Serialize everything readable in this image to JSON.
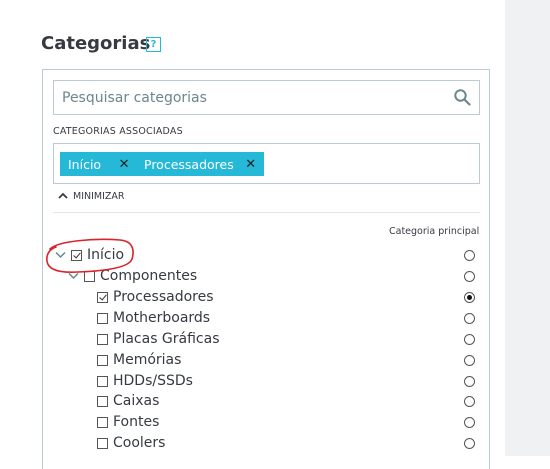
{
  "title": "Categorias",
  "help_icon": "?",
  "search": {
    "placeholder": "Pesquisar categorias",
    "value": ""
  },
  "associated_label": "CATEGORIAS ASSOCIADAS",
  "tags": [
    {
      "label": "Início"
    },
    {
      "label": "Processadores"
    }
  ],
  "minimize_label": "MINIMIZAR",
  "principal_label": "Categoria principal",
  "tree": [
    {
      "label": "Início",
      "checked": true,
      "expander": "expanded",
      "principal": false
    },
    {
      "label": "Componentes",
      "checked": false,
      "expander": "expanded",
      "principal": false
    },
    {
      "label": "Processadores",
      "checked": true,
      "expander": "",
      "principal": true
    },
    {
      "label": "Motherboards",
      "checked": false,
      "expander": "",
      "principal": false
    },
    {
      "label": "Placas Gráficas",
      "checked": false,
      "expander": "",
      "principal": false
    },
    {
      "label": "Memórias",
      "checked": false,
      "expander": "",
      "principal": false
    },
    {
      "label": "HDDs/SSDs",
      "checked": false,
      "expander": "",
      "principal": false
    },
    {
      "label": "Caixas",
      "checked": false,
      "expander": "",
      "principal": false
    },
    {
      "label": "Fontes",
      "checked": false,
      "expander": "",
      "principal": false
    },
    {
      "label": "Coolers",
      "checked": false,
      "expander": "",
      "principal": false
    }
  ],
  "colors": {
    "accent": "#25b9d7",
    "annotation": "#d9232b",
    "gutter": "#eff1f2"
  },
  "icons": {
    "search": "search-icon",
    "remove_tag": "close-icon",
    "minimize": "chevron-up-icon"
  }
}
